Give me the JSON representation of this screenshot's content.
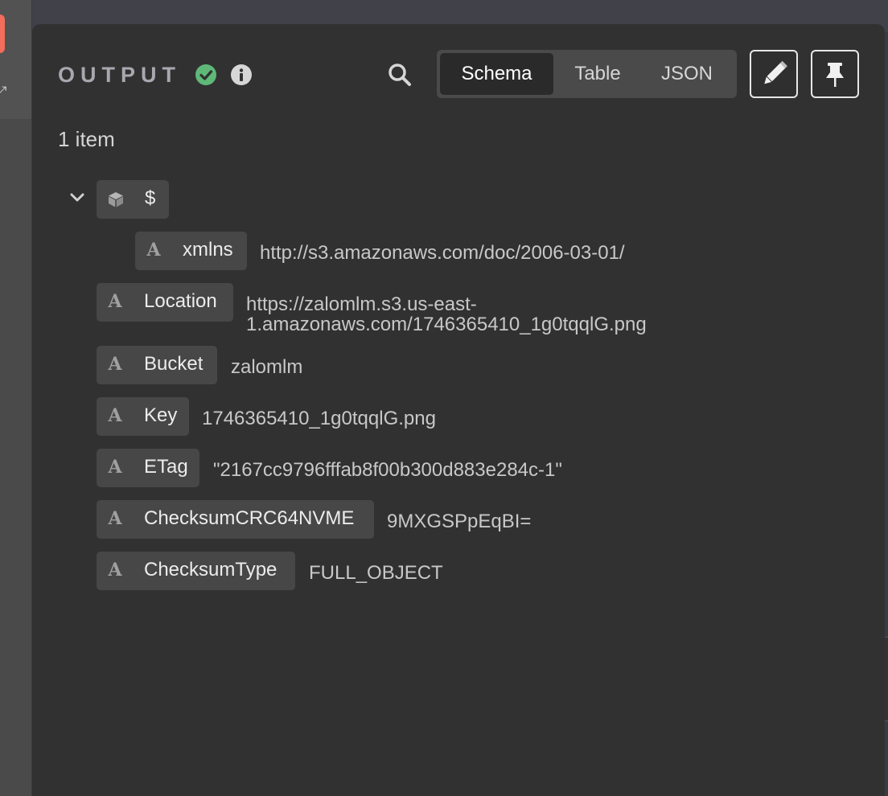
{
  "panel": {
    "title": "OUTPUT",
    "status_icon": "check-circle-icon",
    "info_icon": "info-icon",
    "status_color": "#5fb878"
  },
  "toolbar": {
    "search_icon": "search-icon",
    "views": [
      "Schema",
      "Table",
      "JSON"
    ],
    "active_view": "Schema",
    "edit_icon": "pencil-icon",
    "pin_icon": "pin-icon"
  },
  "item_count": "1 item",
  "schema": {
    "root_label": "$",
    "root_icon": "cube-icon",
    "type_glyph": "A",
    "fields": [
      {
        "key": "xmlns",
        "value": "http://s3.amazonaws.com/doc/2006-03-01/"
      },
      {
        "key": "Location",
        "value_line1": "https://zalomlm.s3.us-east-",
        "value_line2": "1.amazonaws.com/1746365410_1g0tqqlG.png"
      },
      {
        "key": "Bucket",
        "value": "zalomlm"
      },
      {
        "key": "Key",
        "value": "1746365410_1g0tqqlG.png"
      },
      {
        "key": "ETag",
        "value": "\"2167cc9796fffab8f00b300d883e284c-1\""
      },
      {
        "key": "ChecksumCRC64NVME",
        "value": "9MXGSPpEqBI="
      },
      {
        "key": "ChecksumType",
        "value": "FULL_OBJECT"
      }
    ]
  }
}
